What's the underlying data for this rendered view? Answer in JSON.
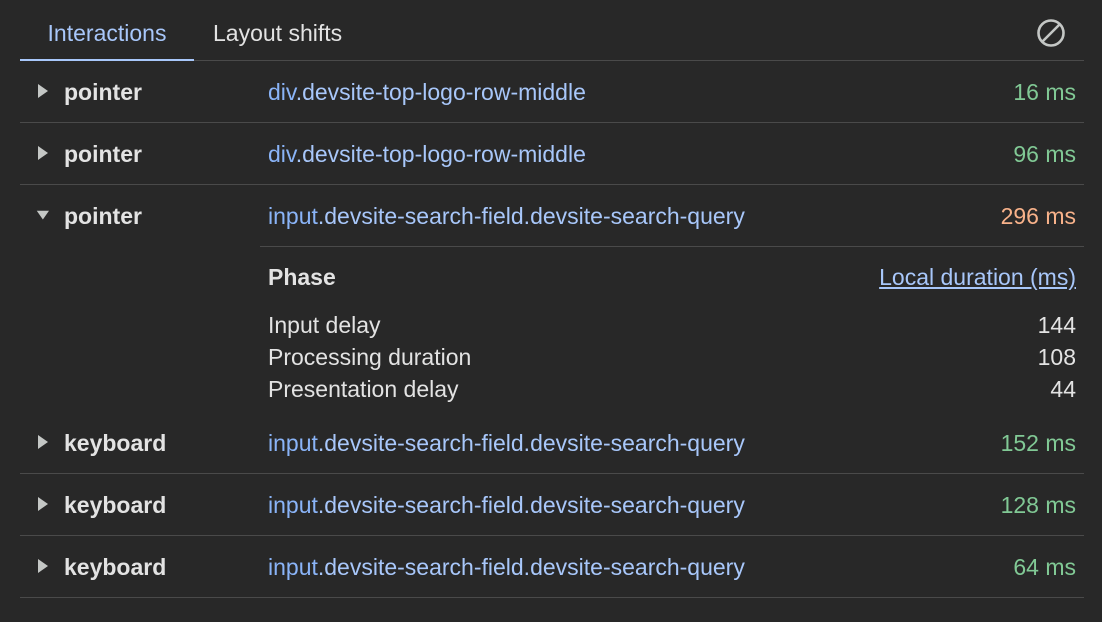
{
  "tabs": {
    "interactions": "Interactions",
    "layout_shifts": "Layout shifts"
  },
  "clear_icon": "clear-circle-slash-icon",
  "colors": {
    "background": "#282828",
    "accent": "#a8c7fa",
    "good": "#81c995",
    "warn": "#f8b28a",
    "separator": "#4a4a4a"
  },
  "rows": [
    {
      "type": "pointer",
      "tag": "div",
      "classes": ".devsite-top-logo-row-middle",
      "duration": "16 ms"
    },
    {
      "type": "pointer",
      "tag": "div",
      "classes": ".devsite-top-logo-row-middle",
      "duration": "96 ms"
    },
    {
      "type": "pointer",
      "tag": "input",
      "classes": ".devsite-search-field.devsite-search-query",
      "duration": "296 ms"
    },
    {
      "type": "keyboard",
      "tag": "input",
      "classes": ".devsite-search-field.devsite-search-query",
      "duration": "152 ms"
    },
    {
      "type": "keyboard",
      "tag": "input",
      "classes": ".devsite-search-field.devsite-search-query",
      "duration": "128 ms"
    },
    {
      "type": "keyboard",
      "tag": "input",
      "classes": ".devsite-search-field.devsite-search-query",
      "duration": "64 ms"
    }
  ],
  "details": {
    "phase_header": "Phase",
    "duration_header": "Local duration (ms)",
    "phases": [
      {
        "name": "Input delay",
        "value": "144"
      },
      {
        "name": "Processing duration",
        "value": "108"
      },
      {
        "name": "Presentation delay",
        "value": "44"
      }
    ]
  }
}
